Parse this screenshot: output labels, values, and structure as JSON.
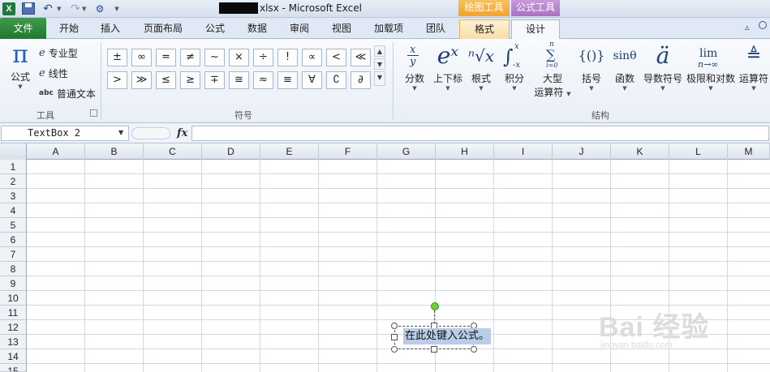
{
  "titlebar": {
    "window_title": "xlsx - Microsoft Excel",
    "context_drawing": "绘图工具",
    "context_formula": "公式工具"
  },
  "tabs": [
    "文件",
    "开始",
    "插入",
    "页面布局",
    "公式",
    "数据",
    "审阅",
    "视图",
    "加载项",
    "团队",
    "格式",
    "设计"
  ],
  "ribbon": {
    "tools": {
      "formula_label": "公式",
      "professional": "专业型",
      "linear": "线性",
      "plain_text": "普通文本",
      "plain_text_icon": "abc",
      "group_label": "工具"
    },
    "symbols": {
      "row1": [
        "±",
        "∞",
        "=",
        "≠",
        "~",
        "×",
        "÷",
        "!",
        "∝",
        "<",
        "≪"
      ],
      "row2": [
        ">",
        "≫",
        "≤",
        "≥",
        "∓",
        "≅",
        "≈",
        "≡",
        "∀",
        "∁",
        "∂"
      ],
      "group_label": "符号"
    },
    "structures": {
      "items": [
        {
          "label": "分数",
          "icon": "fraction-icon"
        },
        {
          "label": "上下标",
          "icon": "script-icon"
        },
        {
          "label": "根式",
          "icon": "radical-icon"
        },
        {
          "label": "积分",
          "icon": "integral-icon"
        },
        {
          "label": "大型",
          "label2": "运算符",
          "icon": "large-operator-icon"
        },
        {
          "label": "括号",
          "icon": "bracket-icon"
        },
        {
          "label": "函数",
          "icon": "function-icon"
        },
        {
          "label": "导数符号",
          "icon": "accent-icon"
        },
        {
          "label": "极限和对数",
          "icon": "limit-log-icon"
        },
        {
          "label": "运算符",
          "icon": "operator-icon"
        }
      ],
      "glyphs": {
        "frac_x": "x",
        "frac_y": "y",
        "script": "eˣ",
        "radical": "ⁿ√x",
        "integral": "∫",
        "integral_upper": "x",
        "integral_lower": "-x",
        "sum": "∑",
        "sum_upper": "n",
        "sum_lower": "i=0",
        "bracket": "{()}",
        "function": "sinθ",
        "accent": "ä",
        "limit_top": "lim",
        "limit_bottom": "n→∞",
        "operator": "≜"
      },
      "group_label": "结构"
    }
  },
  "formula_bar": {
    "name_box": "TextBox 2",
    "fx_label": "fx",
    "formula": ""
  },
  "sheet": {
    "columns": [
      "A",
      "B",
      "C",
      "D",
      "E",
      "F",
      "G",
      "H",
      "I",
      "J",
      "K",
      "L",
      "M"
    ],
    "rows": [
      "1",
      "2",
      "3",
      "4",
      "5",
      "6",
      "7",
      "8",
      "9",
      "10",
      "11",
      "12",
      "13",
      "14",
      "15"
    ]
  },
  "equation_placeholder": "在此处键入公式。",
  "watermark": {
    "brand": "Bai  经验",
    "url": "jingyan.baidu.com"
  },
  "colors": {
    "file_tab": "#2a8a3a",
    "drawing_tools": "#f0a22e",
    "formula_tools": "#a871c3",
    "rotate_handle": "#6ccf3a",
    "selection": "#b9cde8"
  }
}
